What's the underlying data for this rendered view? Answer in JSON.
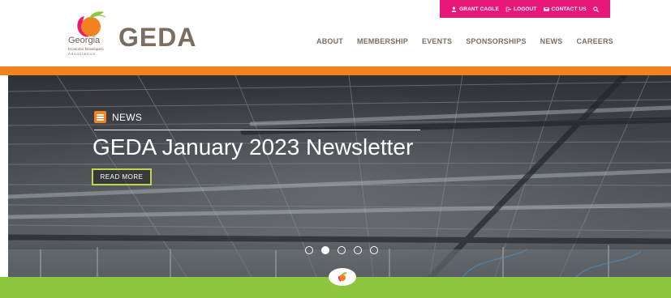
{
  "utility_bar": {
    "user_label": "GRANT CAGLE",
    "logout_label": "LOGOUT",
    "contact_label": "CONTACT US",
    "color": "#e8177a"
  },
  "logo": {
    "state_text": "Georgia",
    "org_line1": "Economic Developers",
    "org_line2": "Association",
    "wordmark": "GEDA"
  },
  "nav": {
    "items": [
      "ABOUT",
      "MEMBERSHIP",
      "EVENTS",
      "SPONSORSHIPS",
      "NEWS",
      "CAREERS"
    ]
  },
  "hero": {
    "category": "NEWS",
    "title": "GEDA January 2023 Newsletter",
    "button_label": "READ MORE",
    "slide_count": 5,
    "active_slide": 2
  },
  "colors": {
    "orange": "#f58220",
    "green": "#8dc63f",
    "pink": "#e8177a",
    "brown": "#7b6d60"
  }
}
